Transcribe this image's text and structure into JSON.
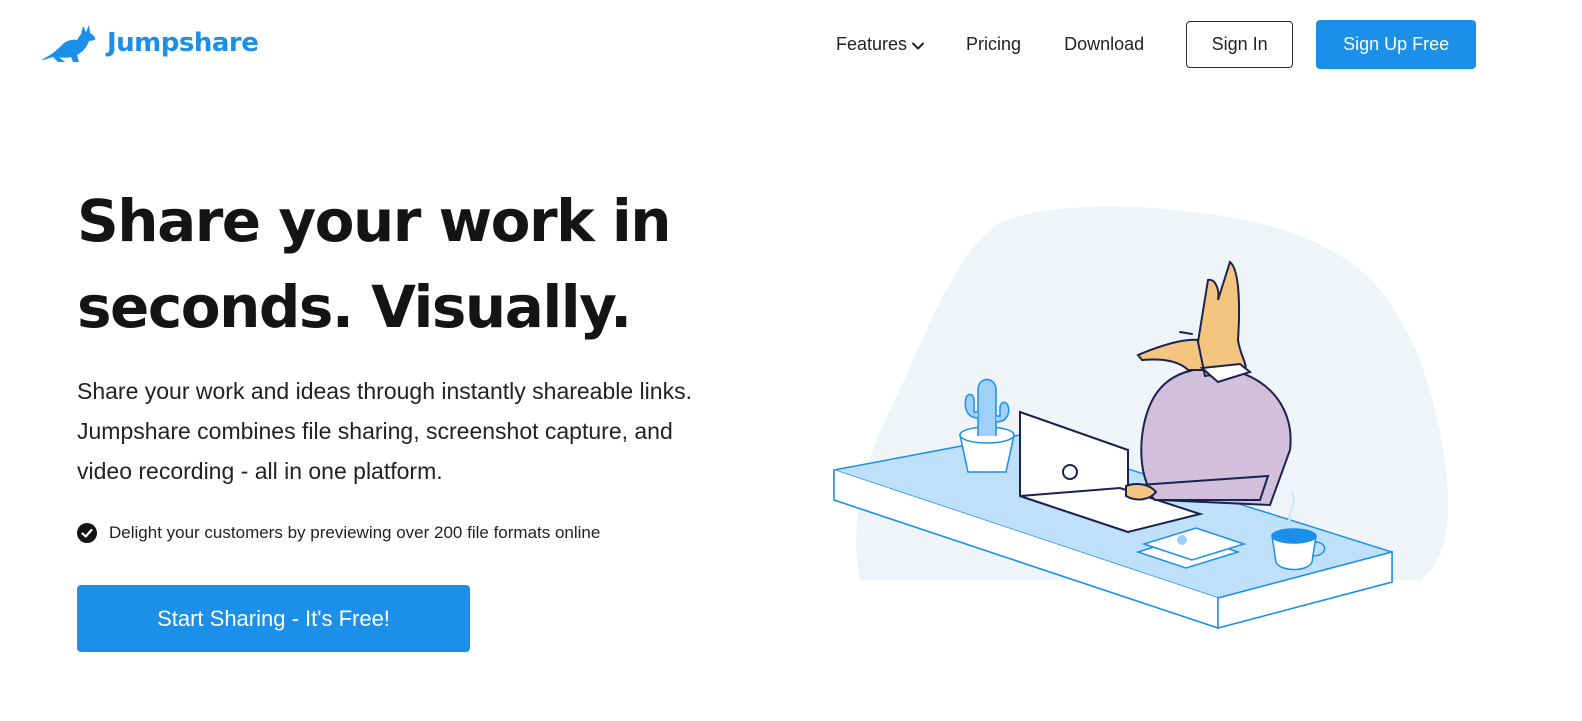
{
  "brand": {
    "name": "Jumpshare",
    "color": "#1c8fe8",
    "logo_icon": "kangaroo-icon"
  },
  "nav": {
    "features": "Features",
    "pricing": "Pricing",
    "download": "Download",
    "sign_in": "Sign In",
    "sign_up": "Sign Up Free"
  },
  "hero": {
    "title_line1": "Share your work in",
    "title_line2": "seconds. Visually.",
    "description_line1": "Share your work and ideas through instantly shareable links.",
    "description_line2": "Jumpshare combines file sharing, screenshot capture, and",
    "description_line3": "video recording - all in one platform.",
    "bullet_icon": "check-circle-icon",
    "bullet": "Delight your customers by previewing over 200 file formats online",
    "cta": "Start Sharing - It's Free!"
  },
  "colors": {
    "primary": "#1c8fe8",
    "text_dark": "#141414",
    "desk": "#bfe0fb",
    "kangaroo": "#f4c57f",
    "sweater": "#d2bfdc",
    "blob": "#eef4f8"
  }
}
